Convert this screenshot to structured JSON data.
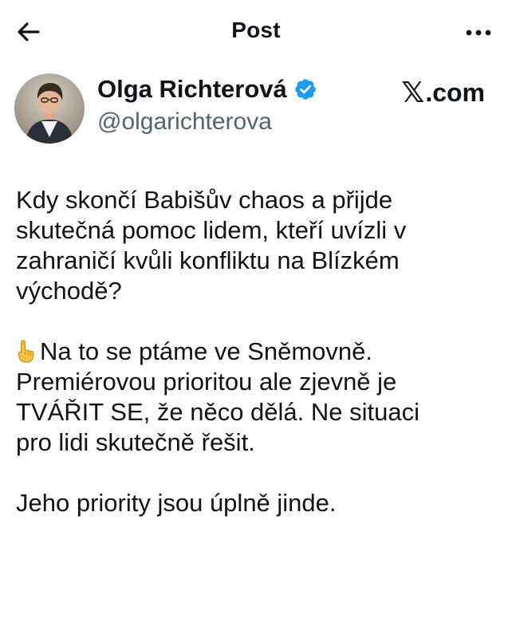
{
  "topbar": {
    "title": "Post",
    "back_icon": "arrow-left-icon",
    "more_icon": "more-horizontal-icon"
  },
  "author": {
    "display_name": "Olga Richterová",
    "handle": "@olgarichterova",
    "verified": true,
    "verified_color": "#1d9bf0"
  },
  "brand": {
    "logo_glyph": "𝕏",
    "label_suffix": ".com"
  },
  "post": {
    "paragraph_1": "Kdy skončí Babišův chaos a přijde\nskutečná pomoc lidem, kteří uvízli v\nzahraničí kvůli konfliktu na Blízkém\nvýchodě?",
    "paragraph_2_emoji": "☝️",
    "paragraph_2_text": "Na to se ptáme ve Sněmovně.\nPremiérovou prioritou ale zjevně je\nTVÁŘIT SE, že něco dělá. Ne situaci\npro lidi skutečně řešit.",
    "paragraph_3": "Jeho priority jsou úplně jinde."
  }
}
